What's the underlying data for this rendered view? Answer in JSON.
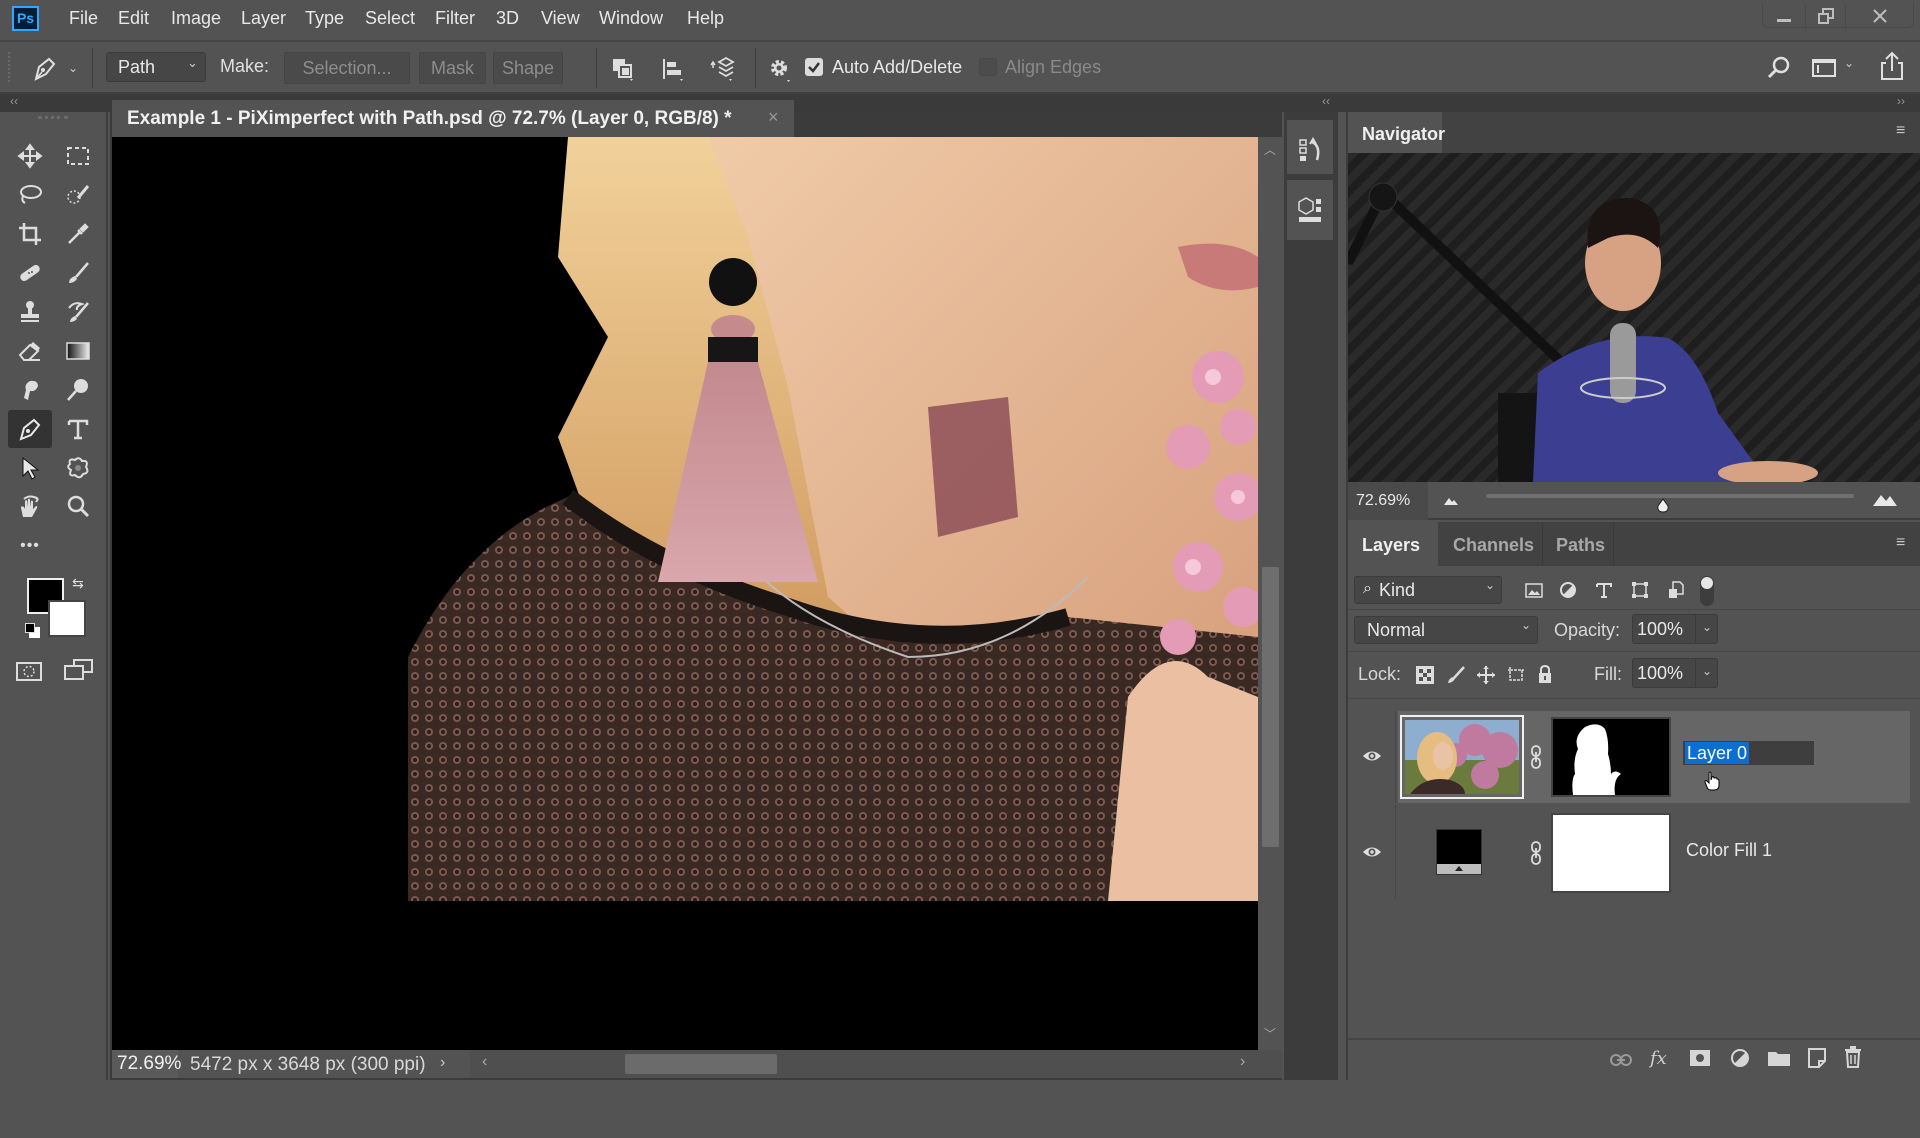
{
  "app": {
    "logo": "Ps",
    "menu": [
      "File",
      "Edit",
      "Image",
      "Layer",
      "Type",
      "Select",
      "Filter",
      "3D",
      "View",
      "Window",
      "Help"
    ],
    "window_controls": {
      "minimize": "minimize-icon",
      "restore": "restore-icon",
      "close": "close-icon"
    }
  },
  "options_bar": {
    "tool_icon": "pen-tool-icon",
    "mode_select": "Path",
    "make_label": "Make:",
    "selection_button": "Selection...",
    "mask_button": "Mask",
    "shape_button": "Shape",
    "path_operations_icon": "path-operations-icon",
    "path_alignment_icon": "path-alignment-icon",
    "path_arrangement_icon": "path-arrangement-icon",
    "settings_icon": "gear-icon",
    "auto_add_delete": {
      "label": "Auto Add/Delete",
      "checked": true
    },
    "align_edges": {
      "label": "Align Edges",
      "checked": false
    },
    "search_icon": "search-icon",
    "workspace_icon": "workspace-icon",
    "share_icon": "share-icon"
  },
  "document": {
    "tab_title": "Example 1 - PiXimperfect with Path.psd @ 72.7% (Layer 0, RGB/8) *",
    "close": "×",
    "zoom": "72.69%",
    "info": "5472 px x 3648 px (300 ppi)",
    "info_arrow": "›",
    "hscroll_left": "‹",
    "hscroll_right": "›",
    "vscroll_up": "︿",
    "vscroll_down": "﹀"
  },
  "toolbar": {
    "tools": [
      [
        "move-tool",
        "rectangular-marquee-tool"
      ],
      [
        "lasso-tool",
        "quick-selection-tool"
      ],
      [
        "crop-tool",
        "eyedropper-tool"
      ],
      [
        "healing-brush-tool",
        "brush-tool"
      ],
      [
        "clone-stamp-tool",
        "history-brush-tool"
      ],
      [
        "eraser-tool",
        "gradient-tool"
      ],
      [
        "smudge-tool",
        "dodge-tool"
      ],
      [
        "pen-tool",
        "type-tool"
      ],
      [
        "path-selection-tool",
        "custom-shape-tool"
      ],
      [
        "rotate-view-tool",
        "zoom-tool"
      ]
    ],
    "active_tool": "pen-tool",
    "more": "•••",
    "foreground_color": "#000000",
    "background_color": "#ffffff"
  },
  "navigator": {
    "title": "Navigator",
    "zoom": "72.69%",
    "zoom_slider_value": 0.48
  },
  "layers_panel": {
    "tabs": [
      "Layers",
      "Channels",
      "Paths"
    ],
    "active_tab": "Layers",
    "filter_kind": "Kind",
    "blend_mode": "Normal",
    "opacity_label": "Opacity:",
    "opacity": "100%",
    "lock_label": "Lock:",
    "fill_label": "Fill:",
    "fill": "100%",
    "layers": [
      {
        "name": "Layer 0",
        "visible": true,
        "selected": true,
        "editing_name": true,
        "has_mask": true
      },
      {
        "name": "Color Fill 1",
        "visible": true,
        "selected": false,
        "editing_name": false,
        "has_mask": true
      }
    ],
    "footer_icons": [
      "link-layers-icon",
      "fx-icon",
      "add-mask-icon",
      "adjustment-layer-icon",
      "group-icon",
      "new-layer-icon",
      "delete-icon"
    ]
  },
  "colors": {
    "ui_bg": "#535353",
    "panel_dark": "#424242",
    "accent_selection": "#0a6fd1",
    "ps_logo_blue": "#31a8ff"
  }
}
